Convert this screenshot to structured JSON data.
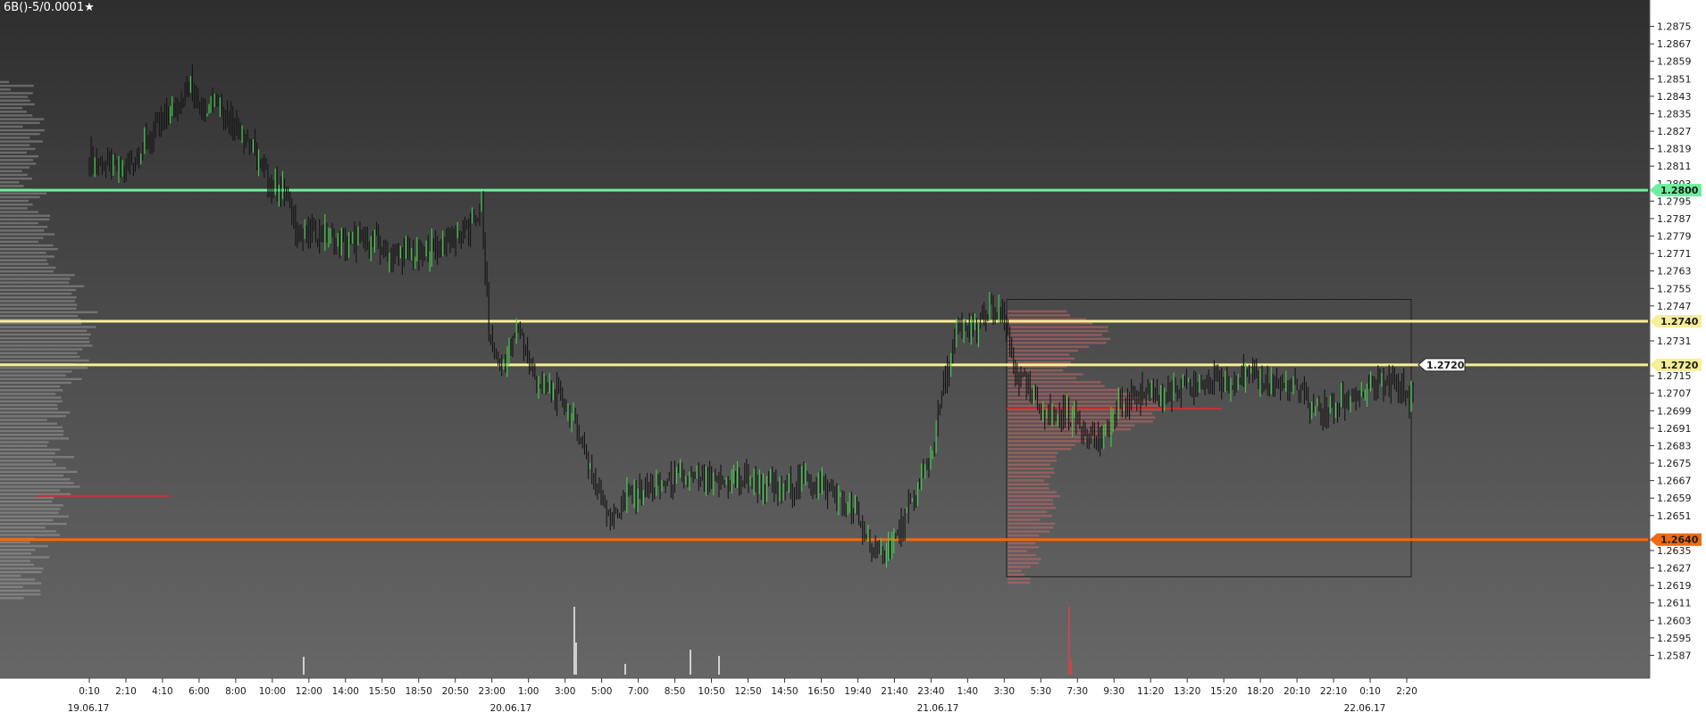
{
  "header": {
    "instrument": "6B()-5/0.0001",
    "favorite_icon": "star-icon"
  },
  "chart_data": {
    "type": "candlestick",
    "ylim": [
      1.2579,
      1.2883
    ],
    "y_ticks": [
      "1.2875",
      "1.2867",
      "1.2859",
      "1.2851",
      "1.2843",
      "1.2835",
      "1.2827",
      "1.2819",
      "1.2811",
      "1.2795",
      "1.2787",
      "1.2779",
      "1.2771",
      "1.2763",
      "1.2755",
      "1.2747",
      "1.2731",
      "1.2715",
      "1.2707",
      "1.2699",
      "1.2691",
      "1.2683",
      "1.2675",
      "1.2667",
      "1.2659",
      "1.2651",
      "1.2635",
      "1.2627",
      "1.2619",
      "1.2611",
      "1.2603",
      "1.2595",
      "1.2587"
    ],
    "x_ticks": [
      "0:10",
      "2:10",
      "4:10",
      "6:00",
      "8:00",
      "10:00",
      "12:00",
      "14:00",
      "15:50",
      "18:50",
      "20:50",
      "23:00",
      "1:00",
      "3:00",
      "5:00",
      "7:00",
      "8:50",
      "10:50",
      "12:50",
      "14:50",
      "16:50",
      "19:40",
      "21:40",
      "23:40",
      "1:40",
      "3:30",
      "5:30",
      "7:30",
      "9:30",
      "11:20",
      "13:20",
      "15:20",
      "18:20",
      "20:10",
      "22:10",
      "0:10",
      "2:20"
    ],
    "date_labels": [
      "19.06.17",
      "20.06.17",
      "21.06.17",
      "22.06.17"
    ],
    "price_path": [
      [
        0,
        1.2815
      ],
      [
        0.02,
        1.2812
      ],
      [
        0.04,
        1.2808
      ],
      [
        0.06,
        1.2818
      ],
      [
        0.08,
        1.2828
      ],
      [
        0.1,
        1.2838
      ],
      [
        0.12,
        1.2848
      ],
      [
        0.135,
        1.2838
      ],
      [
        0.15,
        1.2842
      ],
      [
        0.17,
        1.2832
      ],
      [
        0.19,
        1.2822
      ],
      [
        0.21,
        1.2805
      ],
      [
        0.23,
        1.28
      ],
      [
        0.25,
        1.2778
      ],
      [
        0.27,
        1.2782
      ],
      [
        0.3,
        1.2775
      ],
      [
        0.33,
        1.2778
      ],
      [
        0.36,
        1.277
      ],
      [
        0.39,
        1.277
      ],
      [
        0.42,
        1.2776
      ],
      [
        0.45,
        1.2782
      ],
      [
        0.465,
        1.2792
      ],
      [
        0.475,
        1.273
      ],
      [
        0.49,
        1.2718
      ],
      [
        0.51,
        1.2737
      ],
      [
        0.53,
        1.2712
      ],
      [
        0.56,
        1.2705
      ],
      [
        0.58,
        1.269
      ],
      [
        0.6,
        1.2665
      ],
      [
        0.62,
        1.265
      ],
      [
        0.64,
        1.266
      ],
      [
        0.67,
        1.2664
      ],
      [
        0.7,
        1.2668
      ],
      [
        0.74,
        1.2665
      ],
      [
        0.78,
        1.2668
      ],
      [
        0.82,
        1.2662
      ],
      [
        0.85,
        1.2668
      ],
      [
        0.88,
        1.2662
      ],
      [
        0.91,
        1.265
      ],
      [
        0.935,
        1.2632
      ],
      [
        0.96,
        1.2642
      ],
      [
        0.98,
        1.266
      ],
      [
        1.0,
        1.268
      ],
      [
        1.01,
        1.2705
      ],
      [
        1.03,
        1.2735
      ],
      [
        1.05,
        1.2737
      ],
      [
        1.07,
        1.2745
      ],
      [
        1.085,
        1.274
      ],
      [
        1.1,
        1.2715
      ],
      [
        1.12,
        1.2705
      ],
      [
        1.14,
        1.2697
      ],
      [
        1.16,
        1.2698
      ],
      [
        1.18,
        1.2692
      ],
      [
        1.2,
        1.2685
      ],
      [
        1.22,
        1.27
      ],
      [
        1.25,
        1.2708
      ],
      [
        1.28,
        1.2706
      ],
      [
        1.31,
        1.271
      ],
      [
        1.34,
        1.2713
      ],
      [
        1.37,
        1.2715
      ],
      [
        1.4,
        1.2712
      ],
      [
        1.43,
        1.271
      ],
      [
        1.45,
        1.2701
      ],
      [
        1.47,
        1.2698
      ],
      [
        1.5,
        1.2706
      ],
      [
        1.53,
        1.271
      ],
      [
        1.55,
        1.271
      ],
      [
        1.57,
        1.2705
      ]
    ],
    "horizontal_levels": [
      {
        "price": 1.28,
        "label": "1.2800",
        "color": "#6cef9c"
      },
      {
        "price": 1.274,
        "label": "1.2740",
        "color": "#f6ef97"
      },
      {
        "price": 1.272,
        "label": "1.2720",
        "color": "#f6ef97"
      },
      {
        "price": 1.264,
        "label": "1.2640",
        "color": "#f06a12"
      }
    ],
    "last_price": "1.2720",
    "right_level": "1.2803",
    "grid": false
  }
}
